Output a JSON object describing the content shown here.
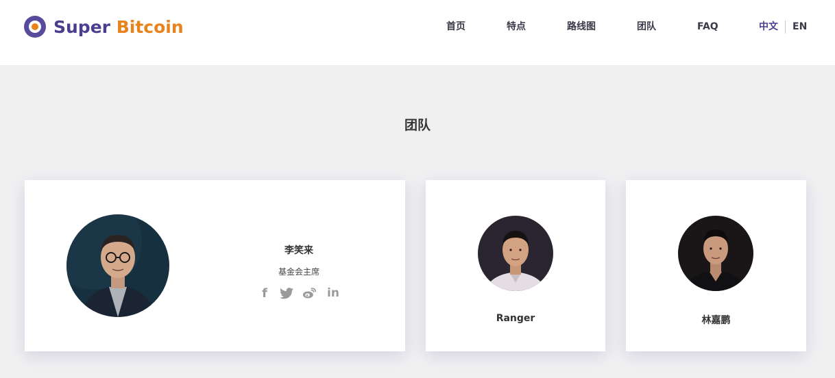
{
  "brand": {
    "name_part1": "Super",
    "name_part2": "Bitcoin",
    "colors": {
      "primary": "#4a3f8f",
      "accent": "#e8821c"
    }
  },
  "nav": {
    "items": [
      {
        "label": "首页"
      },
      {
        "label": "特点"
      },
      {
        "label": "路线图"
      },
      {
        "label": "团队"
      },
      {
        "label": "FAQ"
      }
    ],
    "languages": [
      {
        "label": "中文",
        "active": true
      },
      {
        "label": "EN",
        "active": false
      }
    ]
  },
  "team": {
    "title": "团队",
    "members": [
      {
        "name": "李笑来",
        "role": "基金会主席",
        "social": [
          "facebook-icon",
          "twitter-icon",
          "weibo-icon",
          "linkedin-icon"
        ]
      },
      {
        "name": "Ranger"
      },
      {
        "name": "林嘉鹏"
      }
    ]
  }
}
